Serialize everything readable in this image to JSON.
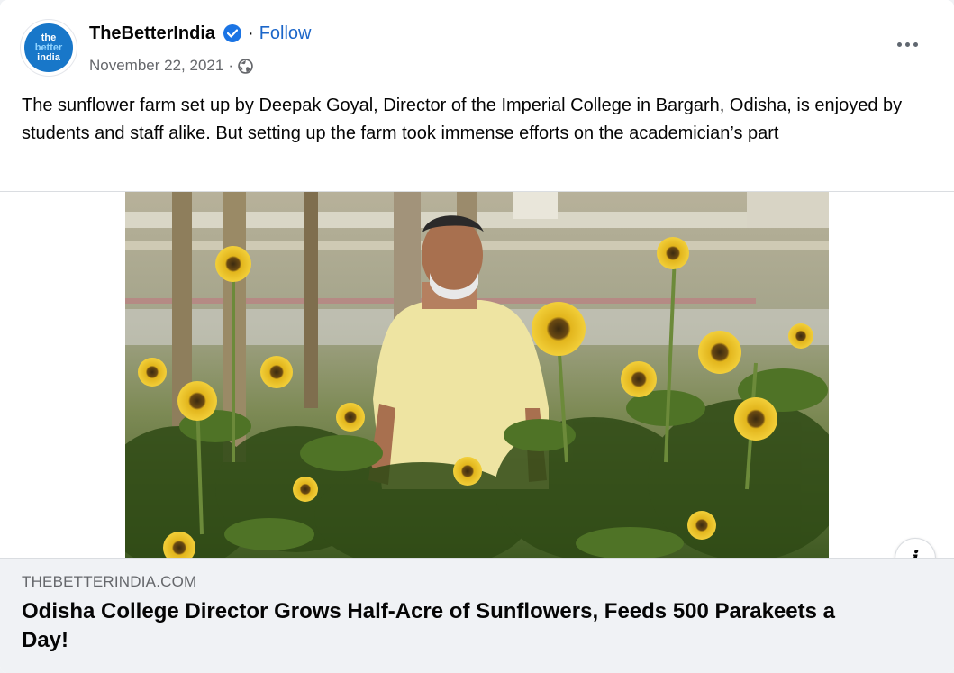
{
  "post": {
    "page_name": "TheBetterIndia",
    "follow_label": "Follow",
    "date": "November 22, 2021",
    "avatar_text": [
      "the",
      "better",
      "india"
    ],
    "caption": "The sunflower farm set up by Deepak Goyal, Director of the Imperial College in Bargarh, Odisha, is enjoyed by students and staff alike. But setting up the farm took immense efforts on the academician’s part",
    "icons": {
      "verified": "verified-badge-icon",
      "privacy": "globe-icon",
      "more": "more-options-icon",
      "info": "info-icon"
    }
  },
  "link_preview": {
    "domain": "THEBETTERINDIA.COM",
    "title": "Odisha College Director Grows Half-Acre of Sunflowers, Feeds 500 Parakeets a Day!",
    "info_glyph": "i"
  },
  "colors": {
    "link_blue": "#1b66c9",
    "verified_blue": "#1b74e4",
    "avatar_blue": "#1877c9",
    "preview_bg": "#f0f2f5"
  }
}
